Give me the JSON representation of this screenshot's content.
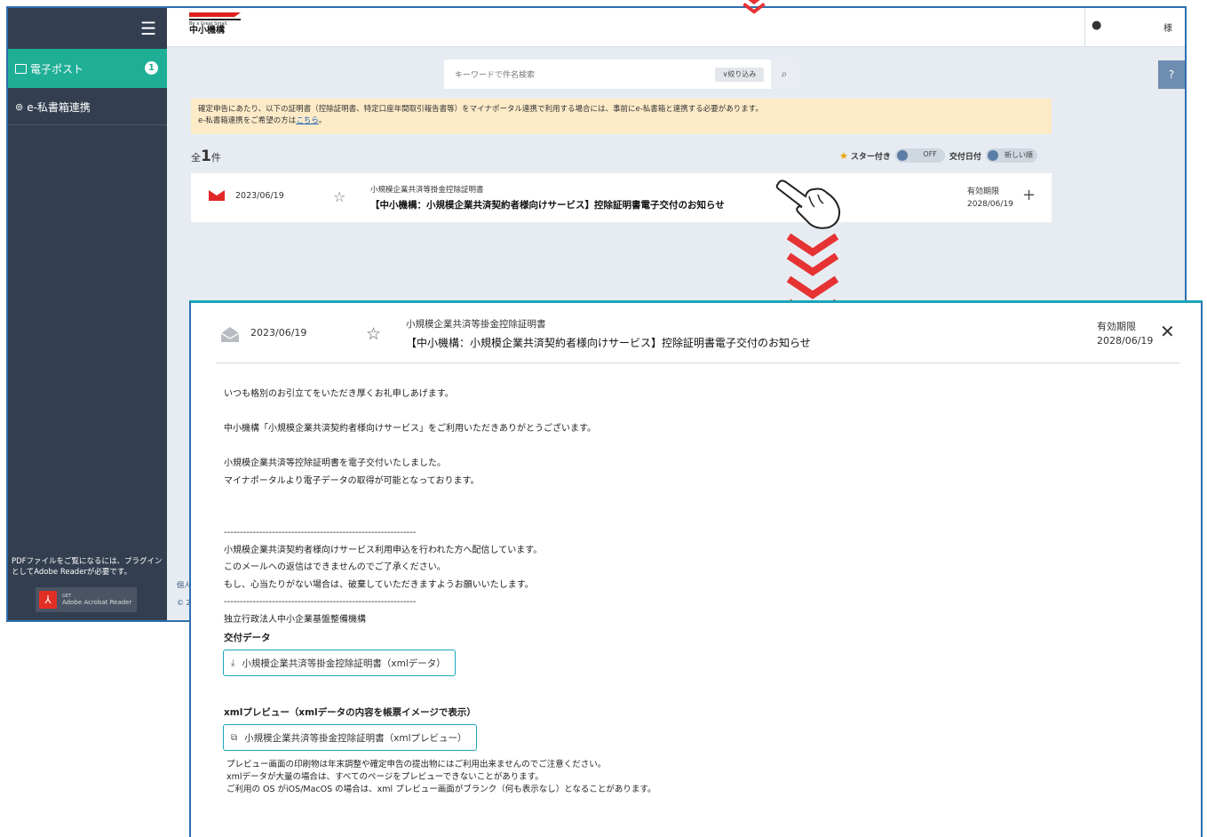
{
  "colors": {
    "sidebar_bg": "#333f50",
    "nav_active": "#1fae96",
    "accent_red": "#e02828",
    "notice_bg": "#fdebc8",
    "teal_border": "#1aa6b7"
  },
  "sidebar": {
    "menu_icon": "hamburger-icon",
    "items": [
      {
        "label": "電子ポスト",
        "icon": "inbox-icon",
        "badge": "1"
      },
      {
        "label": "e-私書箱連携",
        "icon": "link-icon"
      }
    ],
    "pdf_note": "PDFファイルをご覧になるには、プラグインとしてAdobe Readerが必要です。",
    "adobe_get": "GET",
    "adobe_label": "Adobe Acrobat Reader"
  },
  "header": {
    "tagline": "Be a Great Small.",
    "logo_name": "中小機構",
    "user_suffix": "様"
  },
  "search": {
    "placeholder": "キーワードで件名検索",
    "filter_label": "∨絞り込み"
  },
  "notice": {
    "line1": "確定申告にあたり、以下の証明書（控除証明書、特定口座年間取引報告書等）をマイナポータル連携で利用する場合には、事前にe-私書箱と連携する必要があります。",
    "line2_prefix": "e-私書箱連携をご希望の方は",
    "line2_link": "こちら",
    "line2_suffix": "。"
  },
  "list": {
    "count_prefix": "全",
    "count": "1",
    "count_suffix": "件",
    "starred_label": "スター付き",
    "starred_toggle": "OFF",
    "date_label": "交付日付",
    "date_toggle": "新しい順",
    "items": [
      {
        "date": "2023/06/19",
        "category": "小規模企業共済等掛金控除証明書",
        "subject": "【中小機構：小規模企業共済契約者様向けサービス】控除証明書電子交付のお知らせ",
        "expiry_label": "有効期限",
        "expiry": "2028/06/19"
      }
    ]
  },
  "footer_stub": {
    "line1": "個人",
    "line2": "© 2"
  },
  "detail": {
    "date": "2023/06/19",
    "category": "小規模企業共済等掛金控除証明書",
    "subject": "【中小機構：小規模企業共済契約者様向けサービス】控除証明書電子交付のお知らせ",
    "expiry_label": "有効期限",
    "expiry": "2028/06/19",
    "body": [
      "いつも格別のお引立てをいただき厚くお礼申しあげます。",
      "",
      "中小機構「小規模企業共済契約者様向けサービス」をご利用いただきありがとうございます。",
      "",
      "小規模企業共済等控除証明書を電子交付いたしました。",
      "マイナポータルより電子データの取得が可能となっております。",
      "",
      "",
      "------------------------------------------------------------",
      "小規模企業共済契約者様向けサービス利用申込を行われた方へ配信しています。",
      "このメールへの返信はできませんのでご了承ください。",
      "もし、心当たりがない場合は、破棄していただきますようお願いいたします。",
      "------------------------------------------------------------",
      "独立行政法人中小企業基盤整備機構"
    ],
    "data_section_title": "交付データ",
    "download_label": "小規模企業共済等掛金控除証明書（xmlデータ）",
    "preview_section_title": "xmlプレビュー（xmlデータの内容を帳票イメージで表示）",
    "preview_label": "小規模企業共済等掛金控除証明書（xmlプレビュー）",
    "notes": [
      "プレビュー画面の印刷物は年末調整や確定申告の提出物にはご利用出来ませんのでご注意ください。",
      "xmlデータが大量の場合は、すべてのページをプレビューできないことがあります。",
      "ご利用の OS がiOS/MacOS の場合は、xml プレビュー画面がブランク（何も表示なし）となることがあります。"
    ]
  }
}
